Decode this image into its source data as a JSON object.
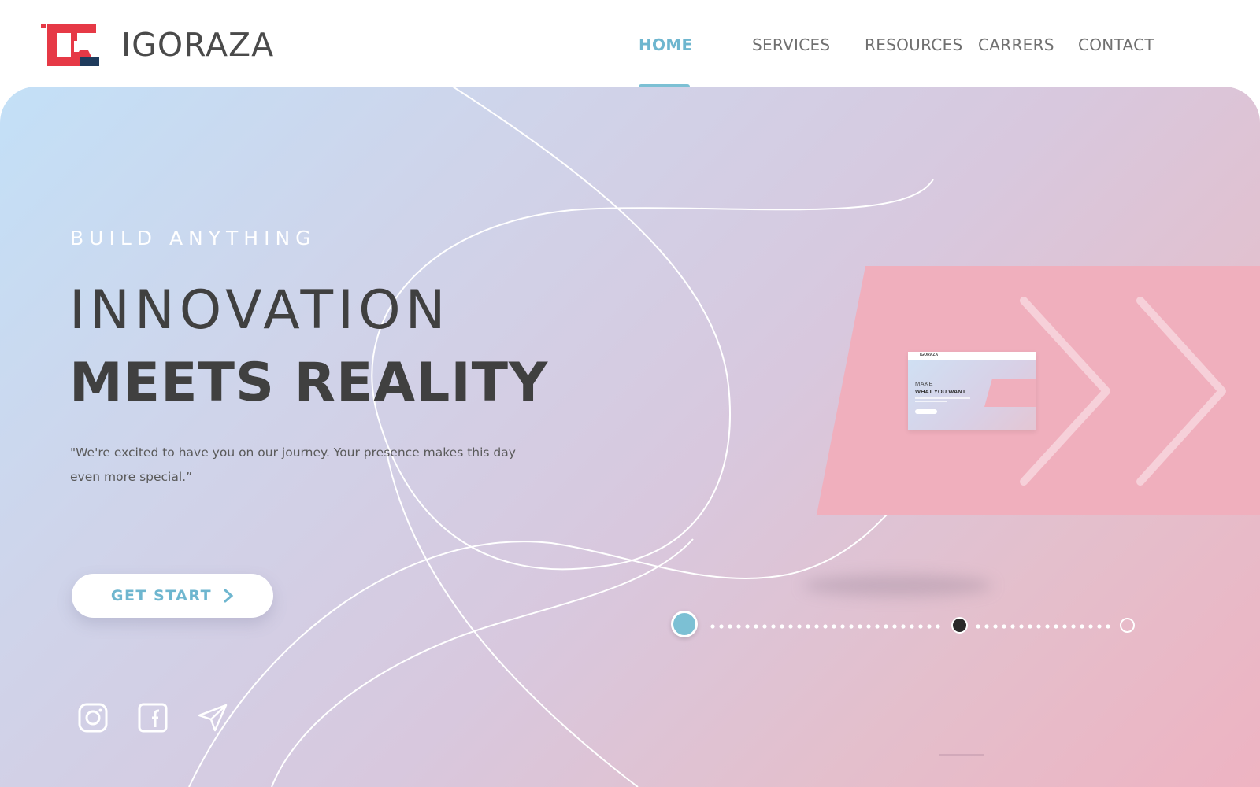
{
  "brand": {
    "name": "IGORAZA",
    "accent": "#e63946",
    "dark": "#1f3b5c"
  },
  "nav": {
    "items": [
      {
        "label": "HOME",
        "active": true
      },
      {
        "label": "SERVICES",
        "active": false
      },
      {
        "label": "RESOURCES",
        "active": false
      },
      {
        "label": "CARRERS",
        "active": false
      },
      {
        "label": "CONTACT",
        "active": false
      }
    ],
    "active_color": "#6eb6cf"
  },
  "hero": {
    "kicker": "BUILD ANYTHING",
    "headline_light": "INNOVATION",
    "headline_bold": "MEETS REALITY",
    "quote": "\"We're excited to have you on our journey. Your presence makes this day even more special.”",
    "cta_label": "GET START",
    "social": [
      "instagram-icon",
      "facebook-icon",
      "send-icon"
    ]
  },
  "preview": {
    "brand": "IGORAZA",
    "headline_light": "MAKE",
    "headline_bold": "WHAT YOU WANT"
  },
  "slider": {
    "slides": 3,
    "current": 1,
    "colors": {
      "active": "#7cc0d4",
      "mid": "#2a2a2a"
    }
  }
}
